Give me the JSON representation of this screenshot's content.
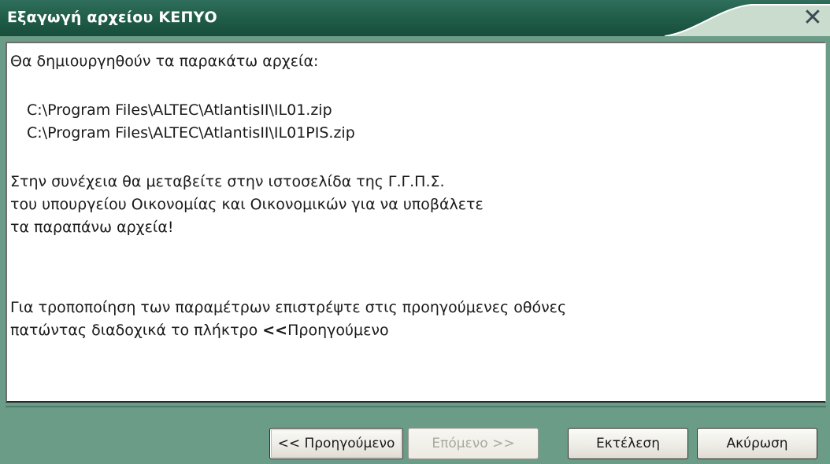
{
  "window": {
    "title": "Εξαγωγή αρχείου ΚΕΠΥΟ",
    "close_label": "✕"
  },
  "message": {
    "intro": "Θα δημιουργηθούν τα παρακάτω αρχεία:",
    "files": [
      "C:\\Program Files\\ALTEC\\AtlantisII\\IL01.zip",
      "C:\\Program Files\\ALTEC\\AtlantisII\\IL01PIS.zip"
    ],
    "paragraph2": [
      "Στην συνέχεια θα μεταβείτε στην ιστοσελίδα της Γ.Γ.Π.Σ.",
      "του υπουργείου Οικονομίας και Οικονομικών για να υποβάλετε",
      "τα παραπάνω αρχεία!"
    ],
    "paragraph3_line1": "Για τροποποίηση των παραμέτρων επιστρέψτε στις προηγούμενες οθόνες",
    "paragraph3_line2_prefix": "πατώντας διαδοχικά το πλήκτρο ",
    "paragraph3_line2_bold": "<<",
    "paragraph3_line2_suffix": "Προηγούμενο"
  },
  "buttons": {
    "previous": "<< Προηγούμενο",
    "next": "Επόμενο >>",
    "execute": "Εκτέλεση",
    "cancel": "Ακύρωση"
  },
  "colors": {
    "titlebar": "#1f5c48",
    "frame": "#6a9c88",
    "disabled_text": "#a9a9a0"
  }
}
